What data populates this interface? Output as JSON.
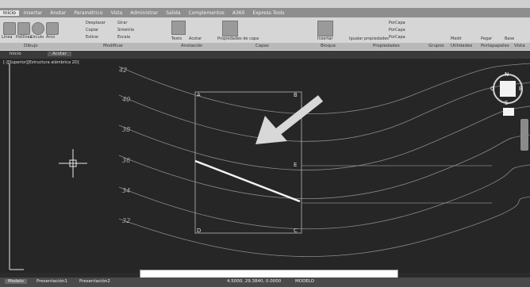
{
  "menu_tabs": [
    "Inicio",
    "Insertar",
    "Anotar",
    "Paramétrico",
    "Vista",
    "Administrar",
    "Salida",
    "Complementos",
    "A360",
    "Express Tools"
  ],
  "active_tab": "Inicio",
  "ribbon": {
    "panels": [
      "Dibujo",
      "Modificar",
      "Anotación",
      "Capas",
      "Bloque",
      "Propiedades",
      "Grupos",
      "Utilidades",
      "Portapapeles",
      "Vista"
    ],
    "draw_tools": [
      "Línea",
      "Polilínea",
      "Círculo",
      "Arco"
    ],
    "modify_tools": [
      "Desplazar",
      "Copiar",
      "Estirar",
      "Girar",
      "Simetría",
      "Escala"
    ],
    "annotation_tools": [
      "Texto",
      "Acotar"
    ],
    "layer_tools": [
      "Propiedades de capa"
    ],
    "block_tools": [
      "Insertar"
    ],
    "property_tools": [
      "Igualar propiedades",
      "PorCapa",
      "PorCapa",
      "PorCapa"
    ],
    "utility_tools": [
      "Medir"
    ],
    "clipboard_tools": [
      "Pegar"
    ],
    "view_tools": [
      "Base"
    ]
  },
  "doc_tabs": [
    "Inicio",
    "Acotar"
  ],
  "viewport_label": "[-][Superior][Estructura alámbrica 2D]",
  "contours": [
    "42",
    "40",
    "38",
    "36",
    "34",
    "32"
  ],
  "points": [
    "A",
    "B",
    "C",
    "D",
    "E"
  ],
  "compass": {
    "n": "N",
    "s": "S",
    "e": "E",
    "w": "O"
  },
  "layout_tabs": [
    "Modelo",
    "Presentación1",
    "Presentación2"
  ],
  "status": {
    "coords": "4.5000, 29.3840, 0.0000",
    "mode": "MODELO"
  }
}
